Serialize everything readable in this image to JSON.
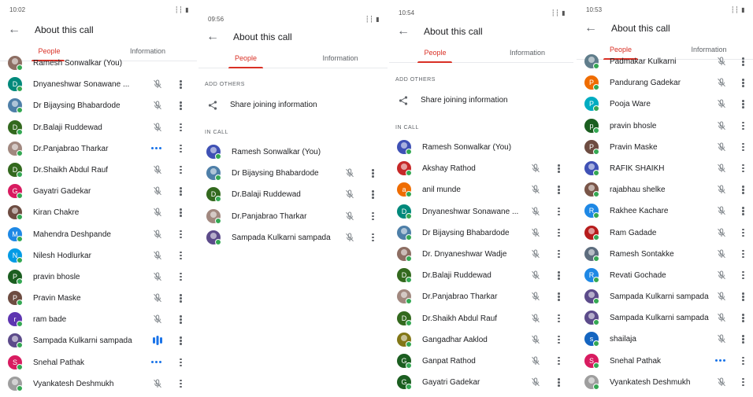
{
  "colors": {
    "accent": "#d93025",
    "online": "#34a853",
    "speaking": "#1a73e8"
  },
  "panels": [
    {
      "status": {
        "time": "10:02",
        "indicators": "✉ ▣ ➤ •",
        "right": "┆┆ ▮"
      },
      "title": "About this call",
      "tabs": [
        "People",
        "Information"
      ],
      "participants": [
        {
          "name": "Ramesh Sonwalkar (You)",
          "letter": "",
          "color": "#8d6e63",
          "photo": true,
          "state": "none"
        },
        {
          "name": "Dnyaneshwar Sonawane ...",
          "letter": "D",
          "color": "#00897b",
          "photo": false,
          "state": "muted"
        },
        {
          "name": "Dr Bijaysing Bhabardode",
          "letter": "",
          "color": "#4e7fa8",
          "photo": true,
          "state": "muted"
        },
        {
          "name": "Dr.Balaji Ruddewad",
          "letter": "D",
          "color": "#33691e",
          "photo": false,
          "state": "muted"
        },
        {
          "name": "Dr.Panjabrao Tharkar",
          "letter": "",
          "color": "#a1887f",
          "photo": true,
          "state": "dots"
        },
        {
          "name": "Dr.Shaikh Abdul Rauf",
          "letter": "D",
          "color": "#33691e",
          "photo": false,
          "state": "muted"
        },
        {
          "name": "Gayatri Gadekar",
          "letter": "G",
          "color": "#d81b60",
          "photo": false,
          "state": "muted"
        },
        {
          "name": "Kiran Chakre",
          "letter": "",
          "color": "#6d4c41",
          "photo": true,
          "state": "muted"
        },
        {
          "name": "Mahendra Deshpande",
          "letter": "M",
          "color": "#1e88e5",
          "photo": false,
          "state": "muted"
        },
        {
          "name": "Nilesh Hodlurkar",
          "letter": "N",
          "color": "#039be5",
          "photo": false,
          "state": "muted"
        },
        {
          "name": "pravin bhosle",
          "letter": "P",
          "color": "#1b5e20",
          "photo": false,
          "state": "muted"
        },
        {
          "name": "Pravin Maske",
          "letter": "P",
          "color": "#6d4c41",
          "photo": false,
          "state": "muted"
        },
        {
          "name": "ram bade",
          "letter": "r",
          "color": "#5e35b1",
          "photo": false,
          "state": "muted"
        },
        {
          "name": "Sampada Kulkarni sampada",
          "letter": "",
          "color": "#5c4b8a",
          "photo": true,
          "state": "speaking"
        },
        {
          "name": "Snehal Pathak",
          "letter": "S",
          "color": "#d81b60",
          "photo": false,
          "state": "dots"
        },
        {
          "name": "Vyankatesh Deshmukh",
          "letter": "",
          "color": "#9e9e9e",
          "photo": true,
          "state": "muted"
        }
      ]
    },
    {
      "status": {
        "time": "09:56",
        "indicators": "➤ ❄ ▣ •",
        "right": "┆┆ ▮"
      },
      "title": "About this call",
      "tabs": [
        "People",
        "Information"
      ],
      "add_others": "ADD OTHERS",
      "share": "Share joining information",
      "in_call": "IN CALL",
      "participants": [
        {
          "name": "Ramesh Sonwalkar (You)",
          "letter": "",
          "color": "#3f51b5",
          "photo": true,
          "state": "none"
        },
        {
          "name": "Dr Bijaysing Bhabardode",
          "letter": "",
          "color": "#4e7fa8",
          "photo": true,
          "state": "muted"
        },
        {
          "name": "Dr.Balaji Ruddewad",
          "letter": "D",
          "color": "#33691e",
          "photo": false,
          "state": "muted"
        },
        {
          "name": "Dr.Panjabrao Tharkar",
          "letter": "",
          "color": "#a1887f",
          "photo": true,
          "state": "muted"
        },
        {
          "name": "Sampada Kulkarni sampada",
          "letter": "",
          "color": "#5c4b8a",
          "photo": true,
          "state": "muted"
        }
      ]
    },
    {
      "status": {
        "time": "10:54",
        "indicators": "▣ ➤ ❄ •",
        "right": "┆┆ ▮"
      },
      "title": "About this call",
      "tabs": [
        "People",
        "Information"
      ],
      "add_others": "ADD OTHERS",
      "share": "Share joining information",
      "in_call": "IN CALL",
      "participants": [
        {
          "name": "Ramesh Sonwalkar (You)",
          "letter": "",
          "color": "#3f51b5",
          "photo": true,
          "state": "none"
        },
        {
          "name": "Akshay Rathod",
          "letter": "",
          "color": "#c62828",
          "photo": true,
          "state": "muted"
        },
        {
          "name": "anil munde",
          "letter": "a",
          "color": "#ef6c00",
          "photo": false,
          "state": "muted"
        },
        {
          "name": "Dnyaneshwar Sonawane ...",
          "letter": "D",
          "color": "#00897b",
          "photo": false,
          "state": "muted"
        },
        {
          "name": "Dr Bijaysing Bhabardode",
          "letter": "",
          "color": "#4e7fa8",
          "photo": true,
          "state": "muted"
        },
        {
          "name": "Dr. Dnyaneshwar Wadje",
          "letter": "",
          "color": "#8d6e63",
          "photo": true,
          "state": "muted"
        },
        {
          "name": "Dr.Balaji Ruddewad",
          "letter": "D",
          "color": "#33691e",
          "photo": false,
          "state": "muted"
        },
        {
          "name": "Dr.Panjabrao Tharkar",
          "letter": "",
          "color": "#a1887f",
          "photo": true,
          "state": "muted"
        },
        {
          "name": "Dr.Shaikh Abdul Rauf",
          "letter": "D",
          "color": "#33691e",
          "photo": false,
          "state": "muted"
        },
        {
          "name": "Gangadhar Aaklod",
          "letter": "",
          "color": "#827717",
          "photo": true,
          "state": "muted"
        },
        {
          "name": "Ganpat Rathod",
          "letter": "G",
          "color": "#1b5e20",
          "photo": false,
          "state": "muted"
        },
        {
          "name": "Gayatri Gadekar",
          "letter": "G",
          "color": "#1b5e20",
          "photo": false,
          "state": "muted"
        }
      ]
    },
    {
      "status": {
        "time": "10:53",
        "indicators": "➤ ❄ ▣ •",
        "right": "┆┆ ▮"
      },
      "title": "About this call",
      "tabs": [
        "People",
        "Information"
      ],
      "participants": [
        {
          "name": "Padmakar Kulkarni",
          "letter": "",
          "color": "#607d8b",
          "photo": true,
          "state": "muted"
        },
        {
          "name": "Pandurang Gadekar",
          "letter": "P",
          "color": "#ef6c00",
          "photo": false,
          "state": "muted"
        },
        {
          "name": "Pooja Ware",
          "letter": "P",
          "color": "#00acc1",
          "photo": false,
          "state": "muted"
        },
        {
          "name": "pravin bhosle",
          "letter": "p",
          "color": "#1b5e20",
          "photo": false,
          "state": "muted"
        },
        {
          "name": "Pravin Maske",
          "letter": "P",
          "color": "#6d4c41",
          "photo": false,
          "state": "muted"
        },
        {
          "name": "RAFIK SHAIKH",
          "letter": "",
          "color": "#3f51b5",
          "photo": true,
          "state": "muted"
        },
        {
          "name": "rajabhau shelke",
          "letter": "",
          "color": "#795548",
          "photo": true,
          "state": "muted"
        },
        {
          "name": "Rakhee Kachare",
          "letter": "R",
          "color": "#1e88e5",
          "photo": false,
          "state": "muted"
        },
        {
          "name": "Ram Gadade",
          "letter": "",
          "color": "#b71c1c",
          "photo": true,
          "state": "muted"
        },
        {
          "name": "Ramesh Sontakke",
          "letter": "",
          "color": "#5d6d7e",
          "photo": true,
          "state": "muted"
        },
        {
          "name": "Revati Gochade",
          "letter": "R",
          "color": "#1e88e5",
          "photo": false,
          "state": "muted"
        },
        {
          "name": "Sampada Kulkarni sampada",
          "letter": "",
          "color": "#5c4b8a",
          "photo": true,
          "state": "muted"
        },
        {
          "name": "Sampada Kulkarni sampada",
          "letter": "",
          "color": "#5c4b8a",
          "photo": true,
          "state": "muted"
        },
        {
          "name": "shailaja",
          "letter": "s",
          "color": "#1565c0",
          "photo": false,
          "state": "muted"
        },
        {
          "name": "Snehal Pathak",
          "letter": "S",
          "color": "#d81b60",
          "photo": false,
          "state": "dots"
        },
        {
          "name": "Vyankatesh Deshmukh",
          "letter": "",
          "color": "#9e9e9e",
          "photo": true,
          "state": "muted"
        }
      ]
    }
  ]
}
